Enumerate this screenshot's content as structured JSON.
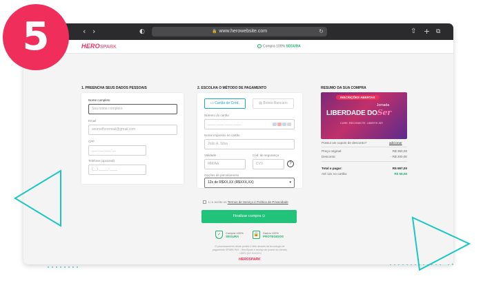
{
  "step": {
    "number": "5"
  },
  "browser": {
    "url": "www.herowebsite.com"
  },
  "header": {
    "logo_hero": "HERO",
    "logo_spark": "SPARK",
    "secure_text": "Compra 100%",
    "secure_bold": "SEGURA"
  },
  "personal": {
    "title": "1. PREENCHA SEUS DADOS PESSOAIS",
    "name_label": "Nome completo",
    "name_placeholder": "Seu nome completo",
    "email_label": "Email",
    "email_placeholder": "seumelhoremail@gmail.com",
    "cpf_label": "CPF",
    "cpf_placeholder": "___.___.___-__",
    "phone_label": "Telefone",
    "phone_optional": "(opcional)",
    "phone_placeholder": "(__) _____-____"
  },
  "payment": {
    "title": "2. ESCOLHA O MÉTODO DE PAGAMENTO",
    "credit_button": "Cartão de Créd.",
    "boleto_button": "Boleto Bancário",
    "card_number_label": "Número do cartão",
    "card_number_placeholder": "____ ____ ____ ____",
    "card_name_label": "Nome impresso no cartão",
    "card_name_placeholder": "João A. Silva",
    "validity_label": "Validade",
    "validity_placeholder": "MM/AA",
    "cvv_label": "Cód. de segurança",
    "cvv_placeholder": "CVV",
    "installments_label": "Opções de parcelamento",
    "installments_value": "12x de R$XX,XX (R$XXX,XX)",
    "terms_prefix": "Li e aceito os",
    "terms_link": "Termos de Serviço e Política de Privacidade",
    "finish_button": "Finalizar compra",
    "badge1_text": "Compra 100%",
    "badge1_bold": "SEGURA",
    "badge2_text": "Dados 100%",
    "badge2_bold": "PROTEGIDOS",
    "note_line1": "O processamento deste pedido é feito através da tecnologia de",
    "note_line2": "pagamento SPARK PAY - HeroSpark é serviço de (nome do cliente)",
    "note_line3": "- CNPJ (XX.XXX/XX)",
    "footer_logo": "HEROSPARK"
  },
  "summary": {
    "title": "RESUMO DA SUA COMPRA",
    "banner_pill": "INSCRIÇÕES ABERTAS",
    "banner_jornada": "Jornada",
    "banner_main": "LIBERDADE DO",
    "banner_ser": "Ser",
    "banner_tagline": "CURE. RECONECTE. LIBERTE-SE!",
    "coupon_text": "Possui um cupom de desconto?",
    "coupon_link": "adicionar",
    "original_label": "Preço original:",
    "original_value": "R$ 350,00",
    "discount_label": "Desconto:",
    "discount_value": "- R$ 200,00",
    "total_label": "Total a pagar:",
    "total_value": "R$ 697,00",
    "installment_label": "Até 12x no cartão:",
    "installment_value": "R$ 58,08"
  },
  "colors": {
    "brand": "#ef2e5c",
    "success": "#21c27a",
    "accent": "#1aa7c9",
    "decor": "#19c6c6"
  }
}
